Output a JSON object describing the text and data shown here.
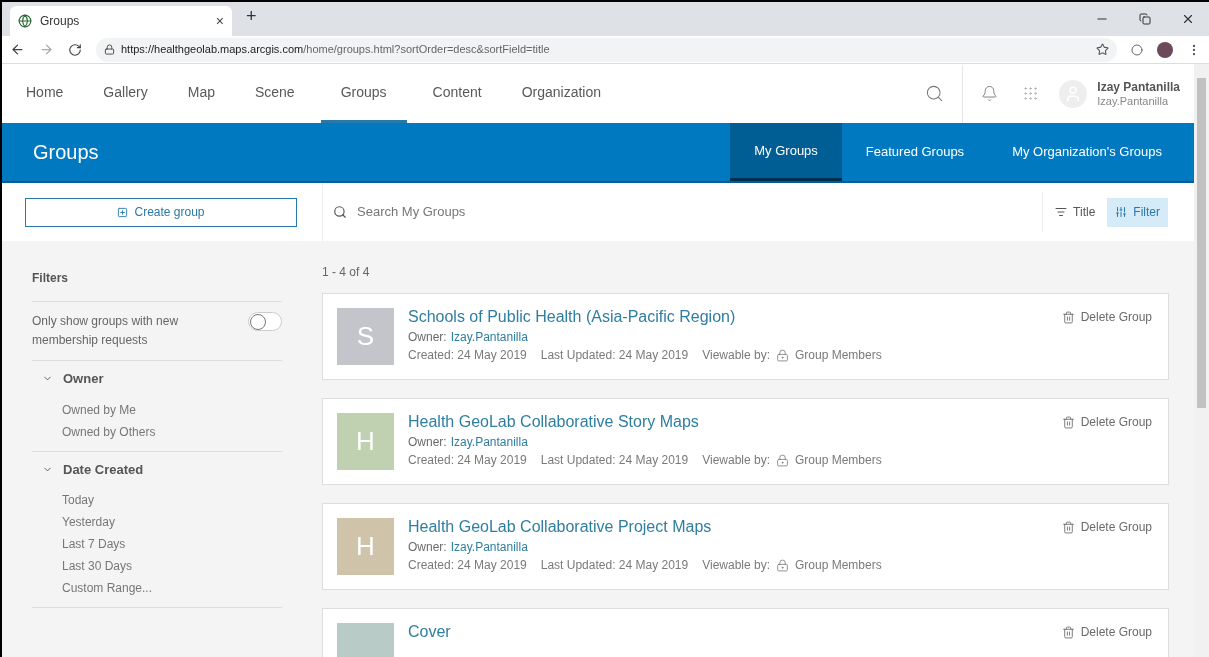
{
  "browser": {
    "tab_title": "Groups",
    "tab_close": "×",
    "new_tab": "+",
    "url_host": "https://healthgeolab.maps.arcgis.com",
    "url_path": "/home/groups.html?sortOrder=desc&sortField=title"
  },
  "nav": {
    "items": [
      {
        "label": "Home",
        "selected": false
      },
      {
        "label": "Gallery",
        "selected": false
      },
      {
        "label": "Map",
        "selected": false
      },
      {
        "label": "Scene",
        "selected": false
      },
      {
        "label": "Groups",
        "selected": true
      },
      {
        "label": "Content",
        "selected": false
      },
      {
        "label": "Organization",
        "selected": false
      }
    ],
    "user": {
      "name": "Izay Pantanilla",
      "username": "Izay.Pantanilla"
    }
  },
  "banner": {
    "title": "Groups",
    "tabs": [
      {
        "label": "My Groups",
        "selected": true
      },
      {
        "label": "Featured Groups",
        "selected": false
      },
      {
        "label": "My Organization's Groups",
        "selected": false
      }
    ]
  },
  "toolbar": {
    "create_button": "Create group",
    "search": {
      "placeholder": "Search My Groups"
    },
    "sort_button": "Title",
    "filter_button": {
      "label": "Filter",
      "selected": true
    }
  },
  "filters": {
    "title": "Filters",
    "toggle": {
      "label": "Only show groups with new membership requests",
      "on": false
    },
    "sections": [
      {
        "title": "Owner",
        "expanded": true,
        "items": [
          "Owned by Me",
          "Owned by Others"
        ]
      },
      {
        "title": "Date Created",
        "expanded": true,
        "items": [
          "Today",
          "Yesterday",
          "Last 7 Days",
          "Last 30 Days",
          "Custom Range..."
        ]
      }
    ]
  },
  "results": {
    "count": "1 - 4 of 4",
    "groups": [
      {
        "letter": "S",
        "color": "#c3c5cb",
        "title": "Schools of Public Health (Asia-Pacific Region)",
        "owner_label": "Owner:",
        "owner": "Izay.Pantanilla",
        "created": "Created: 24 May 2019",
        "updated": "Last Updated: 24 May 2019",
        "viewable_label": "Viewable by:",
        "viewable": "Group Members",
        "delete": "Delete Group"
      },
      {
        "letter": "H",
        "color": "#bfd1b0",
        "title": "Health GeoLab Collaborative Story Maps",
        "owner_label": "Owner:",
        "owner": "Izay.Pantanilla",
        "created": "Created: 24 May 2019",
        "updated": "Last Updated: 24 May 2019",
        "viewable_label": "Viewable by:",
        "viewable": "Group Members",
        "delete": "Delete Group"
      },
      {
        "letter": "H",
        "color": "#cfc3a9",
        "title": "Health GeoLab Collaborative Project Maps",
        "owner_label": "Owner:",
        "owner": "Izay.Pantanilla",
        "created": "Created: 24 May 2019",
        "updated": "Last Updated: 24 May 2019",
        "viewable_label": "Viewable by:",
        "viewable": "Group Members",
        "delete": "Delete Group"
      },
      {
        "color": "#b9cbc6",
        "title": "Cover",
        "delete": "Delete Group"
      }
    ]
  }
}
